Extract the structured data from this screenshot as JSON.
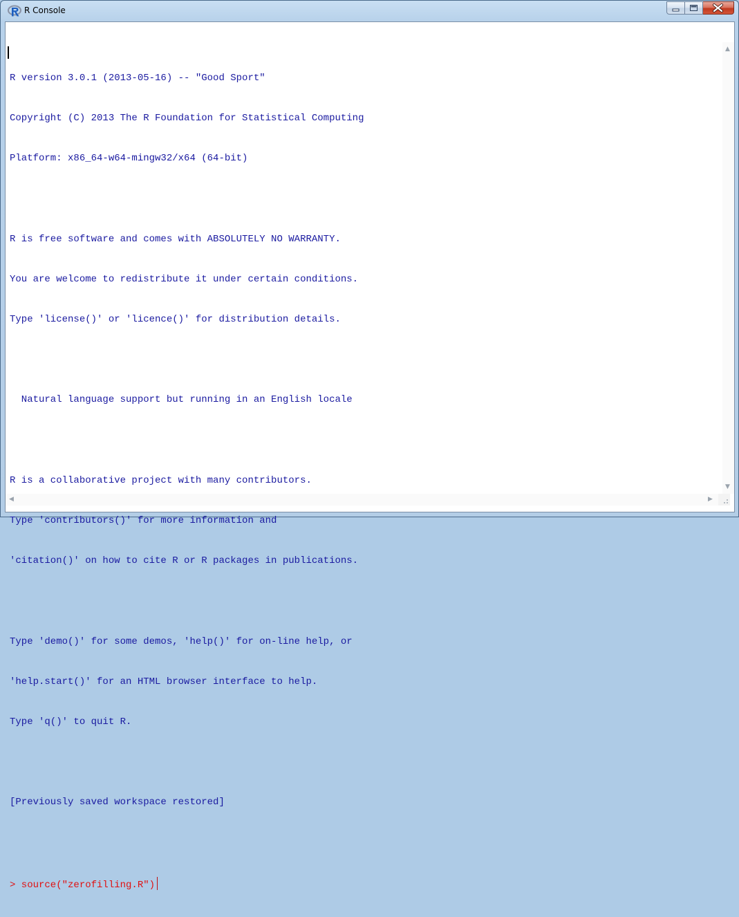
{
  "window": {
    "title": "R Console",
    "icon": "r-logo-icon"
  },
  "caption_buttons": {
    "minimize_icon": "minimize-icon",
    "maximize_icon": "maximize-icon",
    "close_icon": "close-icon"
  },
  "console": {
    "lines": [
      "R version 3.0.1 (2013-05-16) -- \"Good Sport\"",
      "Copyright (C) 2013 The R Foundation for Statistical Computing",
      "Platform: x86_64-w64-mingw32/x64 (64-bit)",
      "",
      "R is free software and comes with ABSOLUTELY NO WARRANTY.",
      "You are welcome to redistribute it under certain conditions.",
      "Type 'license()' or 'licence()' for distribution details.",
      "",
      "  Natural language support but running in an English locale",
      "",
      "R is a collaborative project with many contributors.",
      "Type 'contributors()' for more information and",
      "'citation()' on how to cite R or R packages in publications.",
      "",
      "Type 'demo()' for some demos, 'help()' for on-line help, or",
      "'help.start()' for an HTML browser interface to help.",
      "Type 'q()' to quit R.",
      "",
      "[Previously saved workspace restored]",
      ""
    ],
    "prompt_input": "> source(\"zerofilling.R\")"
  },
  "colors": {
    "output_text": "#1a1aa0",
    "input_text": "#e01010"
  }
}
